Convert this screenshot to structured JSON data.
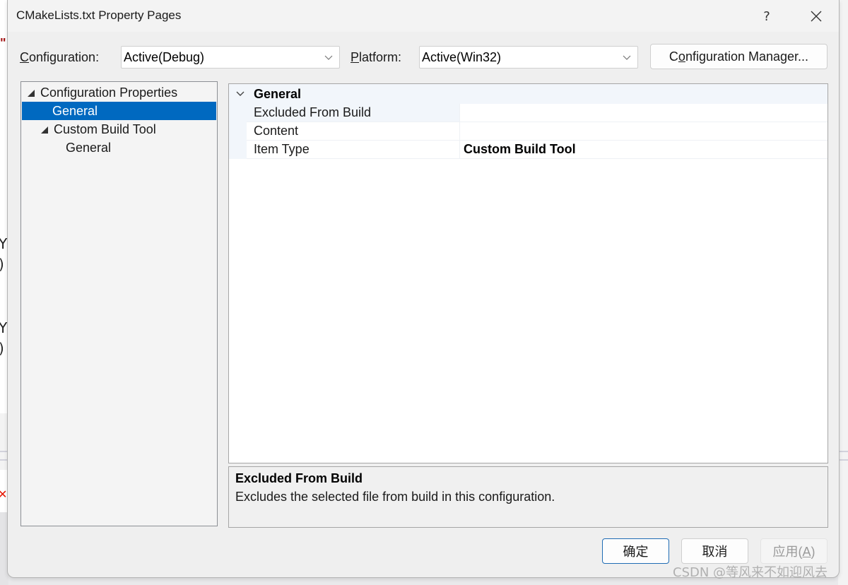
{
  "dialog": {
    "title": "CMakeLists.txt Property Pages",
    "help_label": "?",
    "close_label": "close"
  },
  "toolbar": {
    "configuration_label_access": "C",
    "configuration_label_rest": "onfiguration:",
    "configuration_value": "Active(Debug)",
    "platform_label_access": "P",
    "platform_label_rest": "latform:",
    "platform_value": "Active(Win32)",
    "config_manager_pre": "C",
    "config_manager_access": "o",
    "config_manager_rest": "nfiguration Manager..."
  },
  "tree": {
    "items": [
      {
        "label": "Configuration Properties",
        "expanded": true,
        "selected": false
      },
      {
        "label": "General",
        "selected": true
      },
      {
        "label": "Custom Build Tool",
        "expanded": true,
        "selected": false
      },
      {
        "label": "General",
        "selected": false
      }
    ]
  },
  "grid": {
    "category": "General",
    "rows": [
      {
        "name": "Excluded From Build",
        "value": ""
      },
      {
        "name": "Content",
        "value": ""
      },
      {
        "name": "Item Type",
        "value": "Custom Build Tool"
      }
    ]
  },
  "description": {
    "title": "Excluded From Build",
    "text": "Excludes the selected file from build in this configuration."
  },
  "buttons": {
    "ok": "确定",
    "cancel": "取消",
    "apply_main": "应用(",
    "apply_access": "A",
    "apply_end": ")"
  },
  "watermark": "CSDN @等风来不如迎风去",
  "background": {
    "glyphs": [
      "Y",
      ")",
      "Y",
      ")"
    ]
  },
  "colors": {
    "selection": "#0069c0",
    "default_button_border": "#1f6cb4",
    "dialog_bg": "#efefef"
  }
}
